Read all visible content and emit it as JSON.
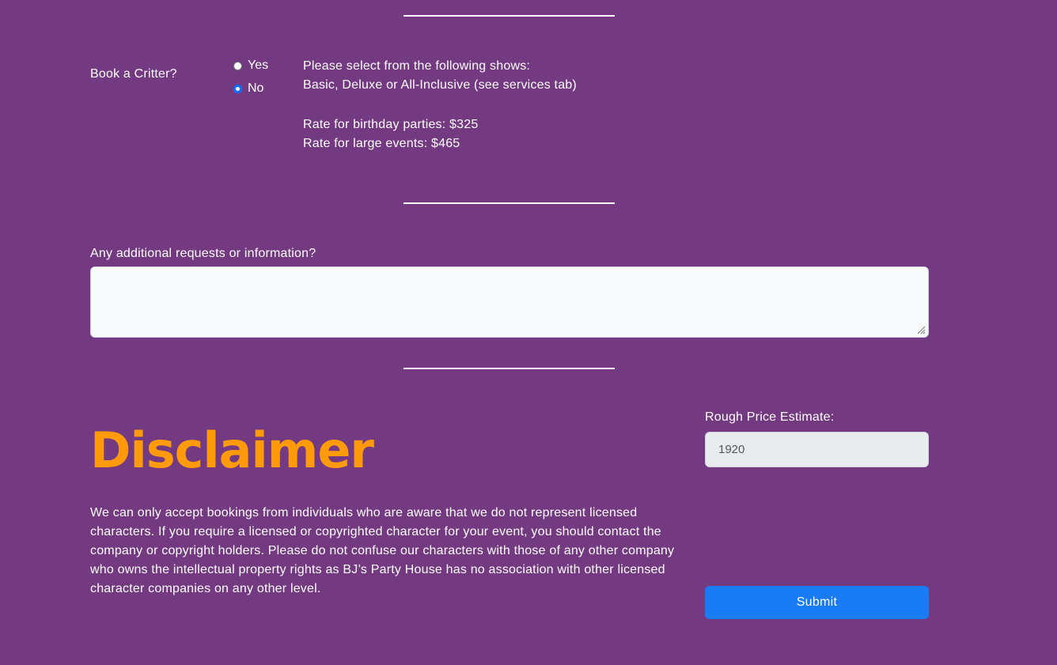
{
  "critter": {
    "question": "Book a Critter?",
    "options": [
      {
        "label": "Yes",
        "selected": false
      },
      {
        "label": "No",
        "selected": true
      }
    ],
    "info_line1": "Please select from the following shows:",
    "info_line2": "Basic, Deluxe or All-Inclusive (see services tab)",
    "rate_birthday": "Rate for birthday parties: $325",
    "rate_events": "Rate for large events: $465"
  },
  "additional": {
    "label": "Any additional requests or information?",
    "value": ""
  },
  "disclaimer": {
    "title": "Disclaimer",
    "text": "We can only accept bookings from individuals who are aware that we do not represent licensed characters. If you require a licensed or copyrighted character for your event, you should contact the company or copyright holders. Please do not confuse our characters with those of any other company who owns the intellectual property rights as BJ’s Party House has no association with other licensed character companies on any other level."
  },
  "estimate": {
    "label": "Rough Price Estimate:",
    "value": "1920"
  },
  "submit": {
    "label": "Submit"
  },
  "colors": {
    "background": "#733981",
    "accent": "#ff9a0b",
    "button": "#1a7cf5"
  }
}
